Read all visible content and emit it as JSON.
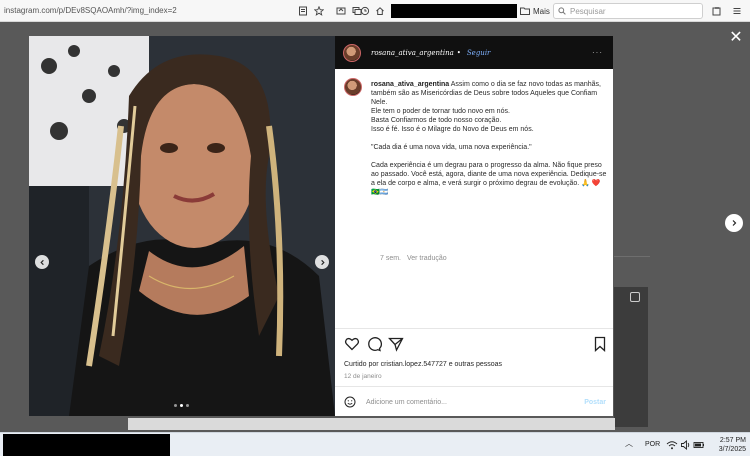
{
  "browser": {
    "url": "instagram.com/p/DEv8SQAOAmh/?img_index=2",
    "folder_label": "Mais",
    "search_placeholder": "Pesquisar"
  },
  "post": {
    "username": "rosana_ativa_argentina",
    "follow_label": "Seguir",
    "more_label": "···",
    "caption_user": "rosana_ativa_argentina",
    "caption_lines": [
      "Assim como o dia se faz novo todas as manhãs, também são as Misericórdias de Deus sobre todos Aqueles que Confiam Nele.",
      "Ele tem o poder de tornar tudo novo em nós.",
      "Basta Confiarmos de todo nosso coração.",
      "Isso é fé. Isso é o Milagre do Novo de Deus em nós."
    ],
    "quote": "\"Cada dia é uma nova vida, uma nova experiência.\"",
    "paragraph": "Cada experiência é um degrau para o progresso da alma. Não fique preso ao passado. Você está, agora, diante de uma nova experiência. Dedique-se a ela de corpo e alma, e verá surgir o próximo degrau de evolução. 🙏 ❤️ 🇧🇷🇦🇷",
    "time_ago": "7 sem.",
    "translate_label": "Ver tradução",
    "liked_prefix": "Curtido por",
    "liked_user": "cristian.lopez.547727",
    "liked_suffix": "e outras pessoas",
    "date": "12 de janeiro",
    "comment_placeholder": "Adicione um comentário...",
    "post_button": "Postar",
    "carousel": {
      "total": 3,
      "active_index": 2
    }
  },
  "taskbar": {
    "language": "POR",
    "time": "2:57 PM",
    "date": "3/7/2025"
  },
  "colors": {
    "accent_link": "#0095f6",
    "follow_blue": "#7fb2ff",
    "overlay": "#595959"
  }
}
